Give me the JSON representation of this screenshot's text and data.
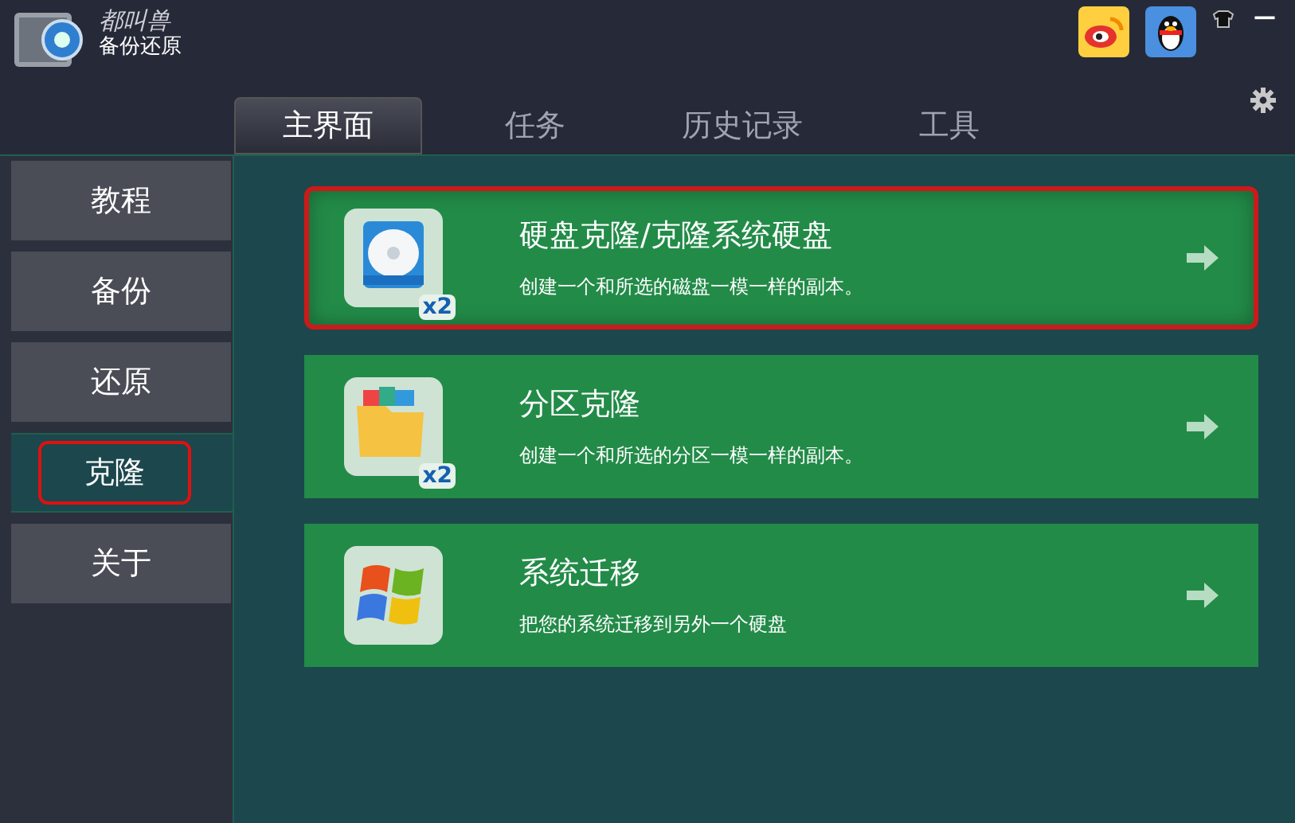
{
  "app": {
    "brand": "都叫兽",
    "name": "备份还原",
    "minimize": "—"
  },
  "tabs": [
    {
      "label": "主界面",
      "selected": true
    },
    {
      "label": "任务",
      "selected": false
    },
    {
      "label": "历史记录",
      "selected": false
    },
    {
      "label": "工具",
      "selected": false
    }
  ],
  "sidebar": {
    "items": [
      {
        "label": "教程",
        "selected": false,
        "highlighted": false
      },
      {
        "label": "备份",
        "selected": false,
        "highlighted": false
      },
      {
        "label": "还原",
        "selected": false,
        "highlighted": false
      },
      {
        "label": "克隆",
        "selected": true,
        "highlighted": true
      },
      {
        "label": "关于",
        "selected": false,
        "highlighted": false
      }
    ]
  },
  "cards": [
    {
      "kind": "disk",
      "title": "硬盘克隆/克隆系统硬盘",
      "description": "创建一个和所选的磁盘一模一样的副本。",
      "badge": "x2",
      "highlighted": true
    },
    {
      "kind": "partition",
      "title": "分区克隆",
      "description": "创建一个和所选的分区一模一样的副本。",
      "badge": "x2",
      "highlighted": false
    },
    {
      "kind": "windows",
      "title": "系统迁移",
      "description": "把您的系统迁移到另外一个硬盘",
      "highlighted": false
    }
  ]
}
